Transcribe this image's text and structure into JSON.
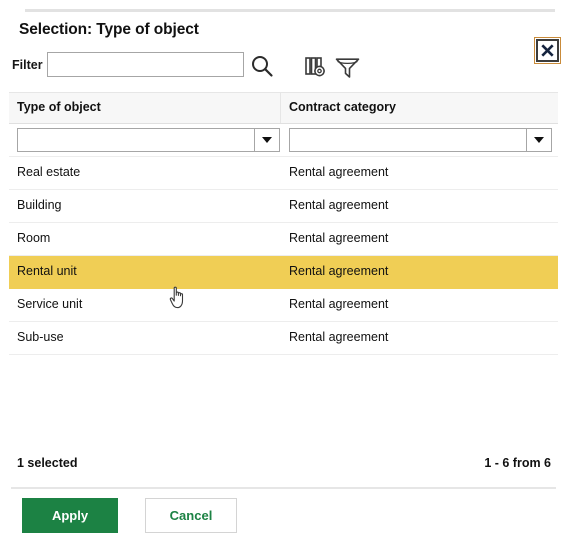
{
  "dialog": {
    "title": "Selection: Type of object",
    "close_icon": "close-icon"
  },
  "filter_bar": {
    "label": "Filter",
    "value": "",
    "placeholder": "",
    "search_icon": "search-icon",
    "columns_icon": "columns-settings-icon",
    "funnel_icon": "filter-funnel-icon"
  },
  "table": {
    "columns": [
      {
        "key": "type_of_object",
        "label": "Type of object"
      },
      {
        "key": "contract_category",
        "label": "Contract category"
      }
    ],
    "column_filters": [
      {
        "value": "",
        "placeholder": ""
      },
      {
        "value": "",
        "placeholder": ""
      }
    ],
    "rows": [
      {
        "type_of_object": "Real estate",
        "contract_category": "Rental agreement",
        "selected": false
      },
      {
        "type_of_object": "Building",
        "contract_category": "Rental agreement",
        "selected": false
      },
      {
        "type_of_object": "Room",
        "contract_category": "Rental agreement",
        "selected": false
      },
      {
        "type_of_object": "Rental unit",
        "contract_category": "Rental agreement",
        "selected": true
      },
      {
        "type_of_object": "Service unit",
        "contract_category": "Rental agreement",
        "selected": false
      },
      {
        "type_of_object": "Sub-use",
        "contract_category": "Rental agreement",
        "selected": false
      }
    ]
  },
  "status": {
    "selected_text": "1 selected",
    "range_text": "1 - 6 from 6"
  },
  "buttons": {
    "apply_label": "Apply",
    "cancel_label": "Cancel"
  },
  "colors": {
    "accent_green": "#1c8244",
    "row_highlight": "#f0ce55",
    "header_bg": "#f7f7f7",
    "border": "#a6a6a6"
  }
}
